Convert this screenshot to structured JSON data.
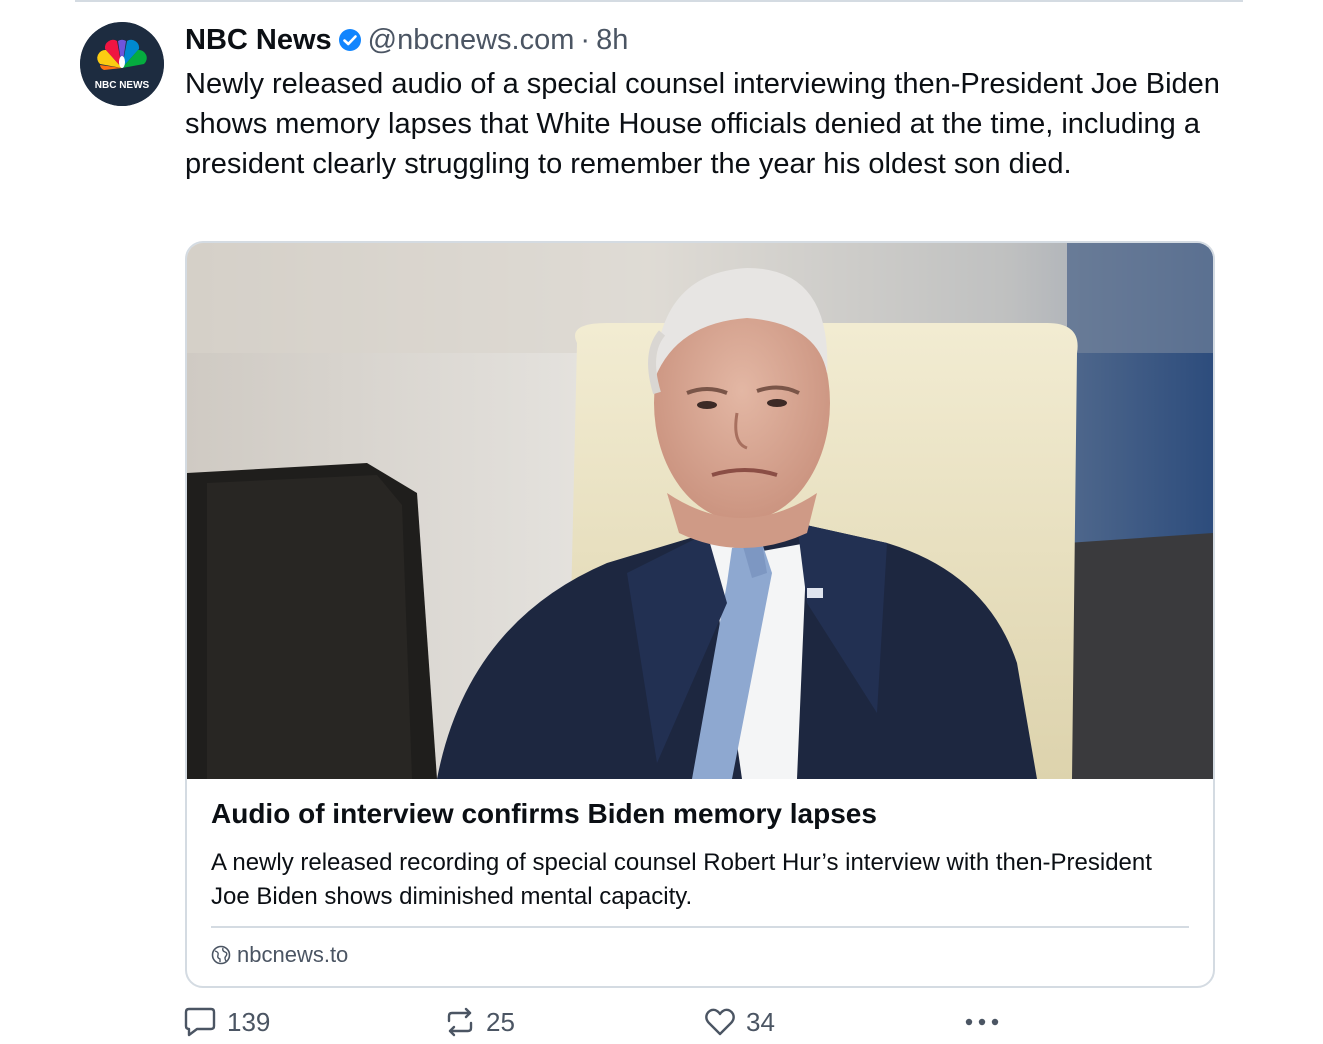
{
  "post": {
    "author": {
      "display_name": "NBC News",
      "handle": "@nbcnews.com",
      "verified": true,
      "avatar_text": "NBC NEWS",
      "avatar_icon": "nbc-peacock-logo"
    },
    "separator": "·",
    "time": "8h",
    "text": "Newly released audio of a special counsel interviewing then-President Joe Biden shows memory lapses that White House officials denied at the time, including a president clearly struggling to remember the year his oldest son died.",
    "link_card": {
      "image_icon": "photo-joe-biden",
      "title": "Audio of interview confirms Biden memory lapses",
      "description": "A newly released recording of special counsel Robert Hur’s interview with then-President Joe Biden shows diminished mental capacity.",
      "domain": "nbcnews.to",
      "domain_icon": "globe-icon"
    },
    "actions": {
      "reply": {
        "icon": "reply-icon",
        "count": "139"
      },
      "repost": {
        "icon": "repost-icon",
        "count": "25"
      },
      "like": {
        "icon": "heart-icon",
        "count": "34"
      },
      "more": {
        "icon": "more-icon"
      }
    }
  },
  "colors": {
    "text": "#0b0f14",
    "muted": "#4b5563",
    "border": "#d4dbe2",
    "verified": "#1185fe",
    "avatar_bg": "#1d2c40"
  }
}
